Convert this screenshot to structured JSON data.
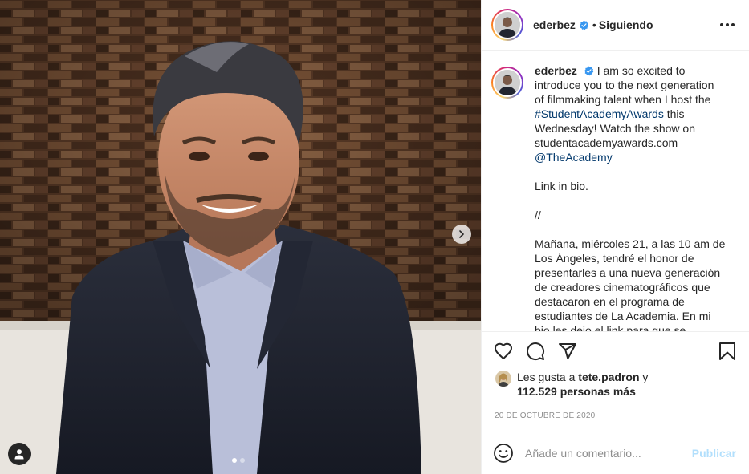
{
  "post": {
    "author": {
      "username": "ederbez",
      "verified": true,
      "follow_separator": "•",
      "follow_status": "Siguiendo"
    },
    "media": {
      "carousel_count": 2,
      "active_index": 0,
      "next_icon": "chevron-right-icon",
      "tag_icon": "user-tag-icon"
    },
    "caption": {
      "username": "ederbez",
      "segments": [
        "I am so excited to introduce you to the next generation of filmmaking talent when I host the ",
        "#StudentAcademyAwards",
        " this Wednesday! Watch the show on studentacademyawards.com ",
        "@TheAcademy"
      ],
      "link_in_bio": "Link in bio.",
      "divider": "//",
      "spanish": "Mañana, miércoles 21, a las 10 am de Los Ángeles, tendré el honor de presentarles a una nueva generación de creadores cinematográficos que destacaron en el programa de estudiantes de La Academia. En mi bio les dejo el link para que se conecten y"
    },
    "likes": {
      "prefix": "Les gusta a",
      "liker": "tete.padron",
      "joiner": "y",
      "others": "112.529 personas más"
    },
    "date": "20 DE OCTUBRE DE 2020",
    "comment_box": {
      "placeholder": "Añade un comentario...",
      "publish_label": "Publicar"
    },
    "colors": {
      "link": "#00376b",
      "verified": "#3897f0",
      "publish_disabled": "#b2dffc",
      "muted": "#8e8e8e"
    }
  }
}
